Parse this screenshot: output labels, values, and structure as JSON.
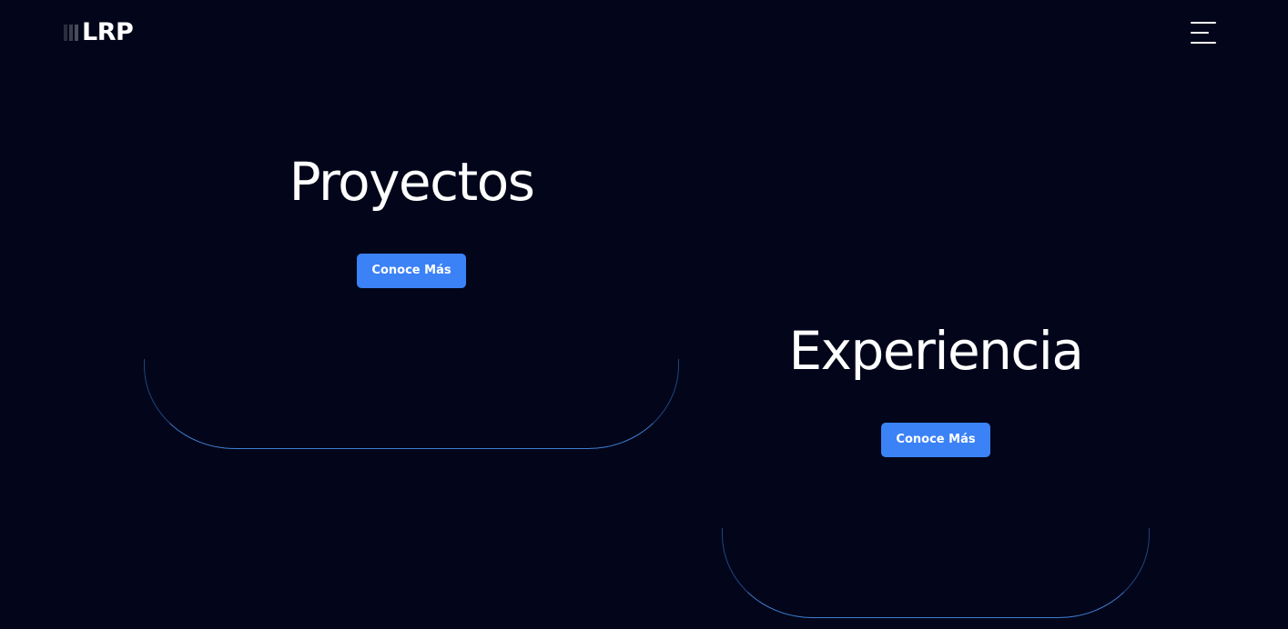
{
  "header": {
    "logo_text": "LRP",
    "menu_icon": "hamburger-menu-icon"
  },
  "cards": [
    {
      "title": "Proyectos",
      "button_label": "Conoce Más"
    },
    {
      "title": "Experiencia",
      "button_label": "Conoce Más"
    }
  ],
  "colors": {
    "background": "#03061a",
    "accent": "#3b82f6",
    "outline": "#3b82f6",
    "text": "#ffffff"
  }
}
